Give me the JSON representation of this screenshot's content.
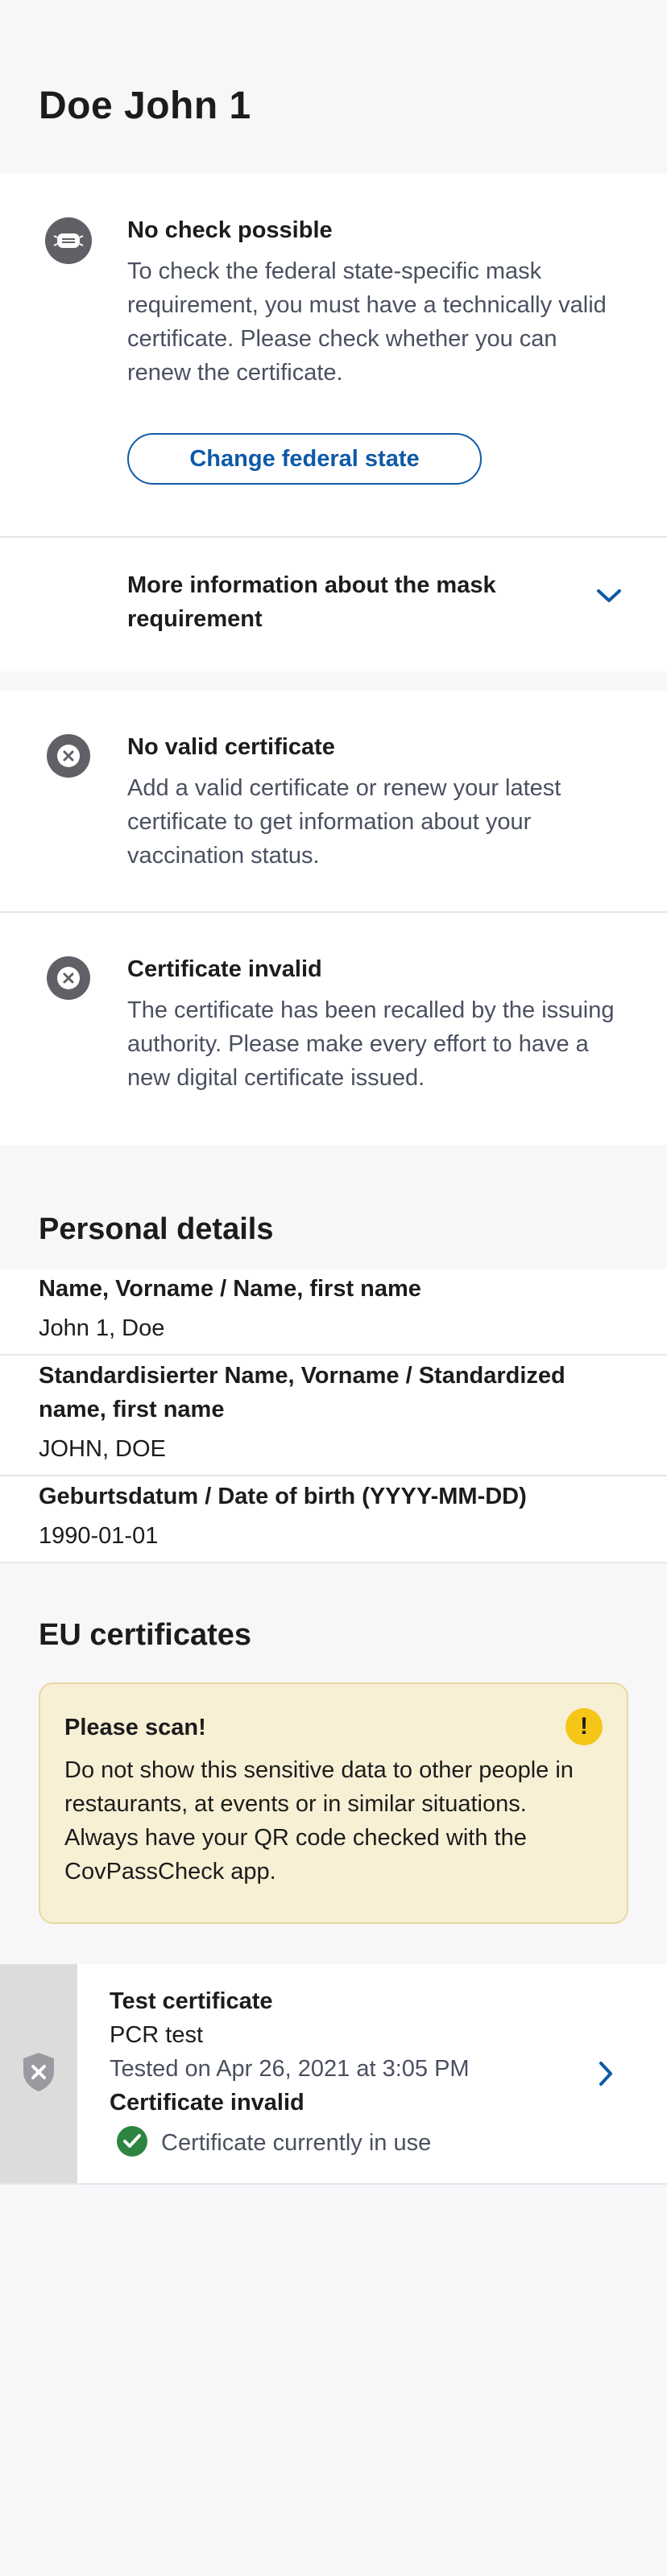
{
  "header": {
    "title": "Doe John 1"
  },
  "mask": {
    "title": "No check possible",
    "text": "To check the federal state-specific mask requirement, you must have a technically valid certificate. Please check whether you can renew the certificate.",
    "button_label": "Change federal state",
    "more_info_label": "More information about the mask requirement"
  },
  "vaccination": {
    "title": "No valid certificate",
    "text": "Add a valid certificate or renew your latest certificate to get information about your vaccination status."
  },
  "invalid": {
    "title": "Certificate invalid",
    "text": "The certificate has been recalled by the issuing authority. Please make every effort to have a new digital certificate issued."
  },
  "personal": {
    "heading": "Personal details",
    "fields": [
      {
        "label": "Name, Vorname / Name, first name",
        "value": "John 1, Doe"
      },
      {
        "label": "Standardisierter Name, Vorname / Standardized name, first name",
        "value": "JOHN, DOE"
      },
      {
        "label": "Geburtsdatum / Date of birth (YYYY-MM-DD)",
        "value": "1990-01-01"
      }
    ]
  },
  "eu": {
    "heading": "EU certificates",
    "notice": {
      "title": "Please scan!",
      "text": "Do not show this sensitive data to other people in restaurants, at events or in similar situations. Always have your QR code checked with the CovPassCheck app."
    },
    "certificate": {
      "type": "Test certificate",
      "test": "PCR test",
      "date": "Tested on Apr 26, 2021 at 3:05 PM",
      "status": "Certificate invalid",
      "in_use": "Certificate currently in use"
    }
  },
  "colors": {
    "accent": "#0e5aa7",
    "check": "#2e8540",
    "warning": "#f5c618"
  }
}
